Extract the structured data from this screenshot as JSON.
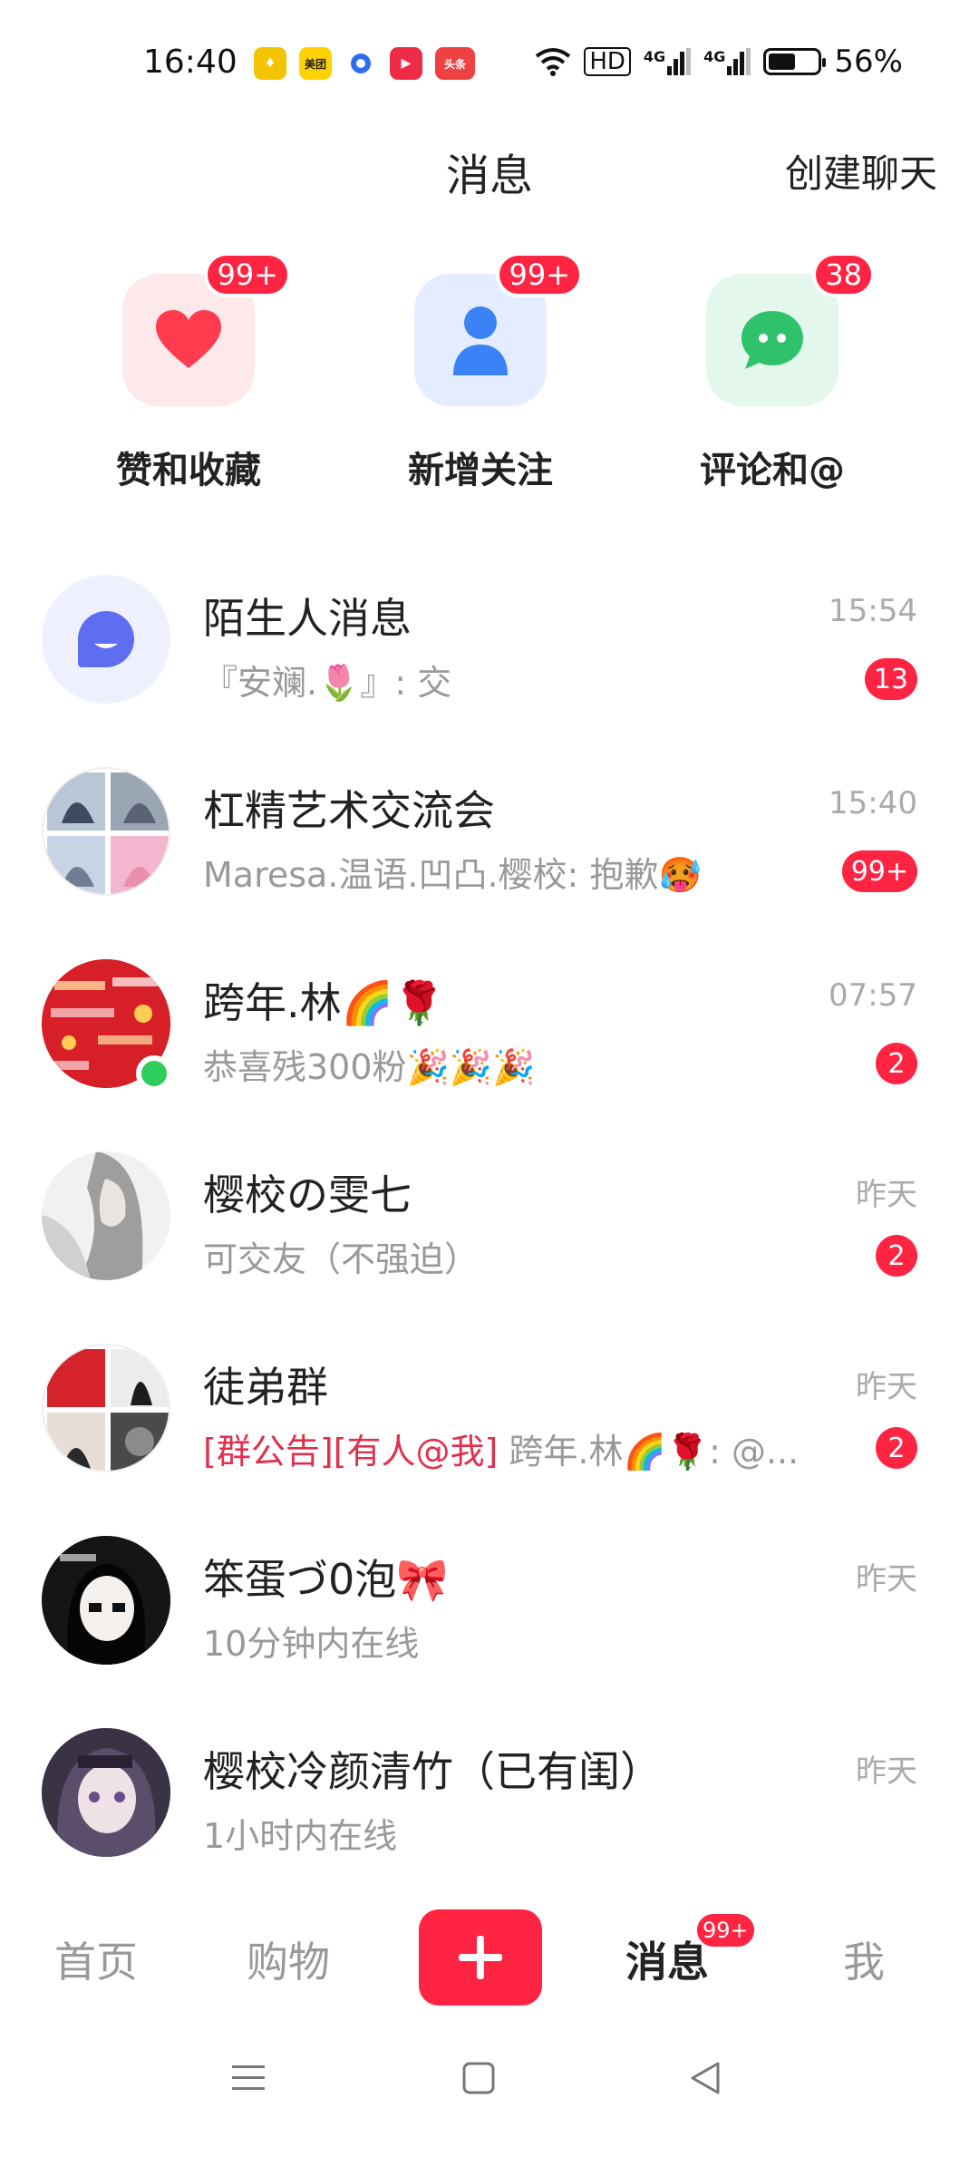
{
  "status_bar": {
    "time": "16:40",
    "app_icons": [
      {
        "name": "yellow-app-icon",
        "text": "",
        "color": "#f5c400"
      },
      {
        "name": "meituan-icon",
        "text": "美团",
        "color": "#ffd100"
      },
      {
        "name": "blue-dot-app-icon",
        "text": "",
        "color": "#2d6cf6"
      },
      {
        "name": "video-app-icon",
        "text": "▶",
        "color": "#ee2b47"
      },
      {
        "name": "toutiao-icon",
        "text": "头条",
        "color": "#f04142"
      }
    ],
    "hd_label": "HD",
    "signal_1": "4G",
    "signal_2": "4G",
    "battery_percent": "56%",
    "battery_level": 0.56
  },
  "header": {
    "title": "消息",
    "create_chat": "创建聊天"
  },
  "quick_actions": [
    {
      "label": "赞和收藏",
      "badge": "99+",
      "icon": "heart-icon",
      "tile_color": "#fde8ea",
      "icon_color": "#ff3b4f"
    },
    {
      "label": "新增关注",
      "badge": "99+",
      "icon": "person-icon",
      "tile_color": "#e3edff",
      "icon_color": "#3a82f6"
    },
    {
      "label": "评论和@",
      "badge": "38",
      "icon": "chat-bubble-icon",
      "tile_color": "#e3f7ec",
      "icon_color": "#2fc26b"
    }
  ],
  "conversations": [
    {
      "name": "陌生人消息",
      "preview": "『安斓.🌷』: 交",
      "time": "15:54",
      "badge": "13",
      "avatar": "stranger-icon"
    },
    {
      "name": "杠精艺术交流会",
      "preview": "Maresa.温语.凹凸.樱校: 抱歉🥵",
      "time": "15:40",
      "badge": "99+",
      "avatar": "group-avatar"
    },
    {
      "name": "跨年.林🌈🌹",
      "preview": "恭喜残300粉🎉🎉🎉",
      "time": "07:57",
      "badge": "2",
      "avatar": "user-avatar",
      "online": true
    },
    {
      "name": "樱校の雯七",
      "preview": "可交友（不强迫）",
      "time": "昨天",
      "badge": "2",
      "avatar": "user-avatar"
    },
    {
      "name": "徒弟群",
      "preview_tag": "[群公告][有人@我]",
      "preview": " 跨年.林🌈🌹: @...",
      "time": "昨天",
      "badge": "2",
      "avatar": "group-avatar"
    },
    {
      "name": "笨蛋づ0泡🎀",
      "preview": "10分钟内在线",
      "time": "昨天",
      "badge": "",
      "avatar": "user-avatar"
    },
    {
      "name": "樱校冷颜清竹（已有闺）",
      "preview": "1小时内在线",
      "time": "昨天",
      "badge": "",
      "avatar": "user-avatar"
    }
  ],
  "bottom_nav": {
    "home": "首页",
    "shop": "购物",
    "messages": "消息",
    "messages_badge": "99+",
    "me": "我"
  },
  "colors": {
    "accent": "#ff2442",
    "online": "#2ecc5b"
  }
}
